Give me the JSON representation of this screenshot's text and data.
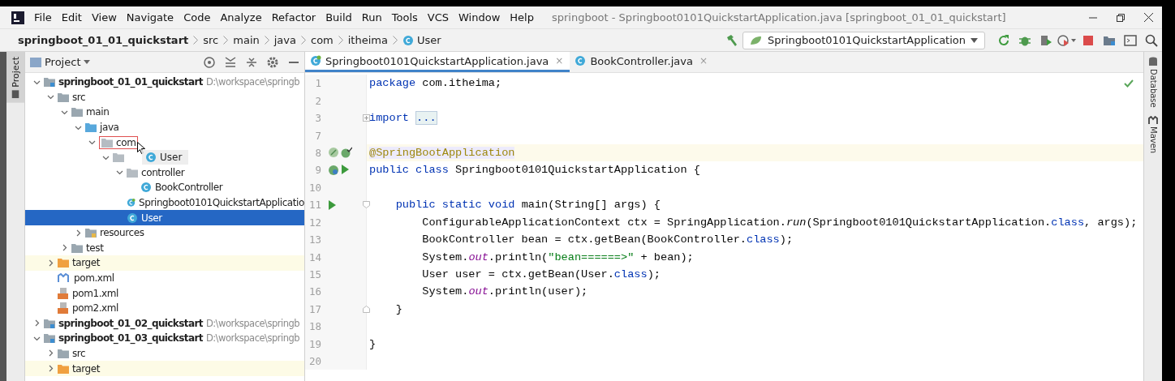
{
  "window": {
    "title": "springboot - Springboot0101QuickstartApplication.java [springboot_01_01_quickstart]"
  },
  "menu": [
    "File",
    "Edit",
    "View",
    "Navigate",
    "Code",
    "Analyze",
    "Refactor",
    "Build",
    "Run",
    "Tools",
    "VCS",
    "Window",
    "Help"
  ],
  "breadcrumbs": [
    {
      "label": "springboot_01_01_quickstart",
      "kind": "module"
    },
    {
      "label": "src",
      "kind": "dir"
    },
    {
      "label": "main",
      "kind": "dir"
    },
    {
      "label": "java",
      "kind": "dir"
    },
    {
      "label": "com",
      "kind": "dir"
    },
    {
      "label": "itheima",
      "kind": "dir"
    },
    {
      "label": "User",
      "kind": "class"
    }
  ],
  "run_config": {
    "label": "Springboot0101QuickstartApplication"
  },
  "side_stripe": {
    "left": "Project",
    "right": [
      "Database",
      "Maven"
    ]
  },
  "project_panel": {
    "title": "Project"
  },
  "tree": [
    {
      "label": "springboot_01_01_quickstart",
      "path": "D:\\workspace\\springb",
      "kind": "module",
      "expanded": true,
      "selected": false,
      "children": [
        {
          "label": "src",
          "kind": "folder",
          "expanded": true,
          "selected": false,
          "children": [
            {
              "label": "main",
              "kind": "folder",
              "expanded": true,
              "selected": false,
              "children": [
                {
                  "label": "java",
                  "kind": "source",
                  "expanded": true,
                  "selected": false,
                  "children": [
                    {
                      "label": "com",
                      "kind": "package",
                      "expanded": true,
                      "selected": false,
                      "drop_target": true,
                      "children": [
                        {
                          "kind": "package",
                          "expanded": true,
                          "selected": false,
                          "drag_ghost": {
                            "label": "User"
                          },
                          "children": [
                            {
                              "label": "controller",
                              "kind": "package",
                              "expanded": true,
                              "selected": false,
                              "children": [
                                {
                                  "label": "BookController",
                                  "kind": "class",
                                  "selected": false
                                }
                              ]
                            },
                            {
                              "label": "Springboot0101QuickstartApplicatio",
                              "kind": "spring",
                              "selected": false
                            },
                            {
                              "label": "User",
                              "kind": "class",
                              "selected": true
                            }
                          ]
                        }
                      ]
                    }
                  ]
                },
                {
                  "label": "resources",
                  "kind": "resources",
                  "expanded": false,
                  "selected": false
                }
              ]
            },
            {
              "label": "test",
              "kind": "folder",
              "expanded": false,
              "selected": false
            }
          ]
        },
        {
          "label": "target",
          "kind": "excluded",
          "expanded": false,
          "selected": false
        },
        {
          "label": "pom.xml",
          "kind": "maven",
          "selected": false
        },
        {
          "label": "pom1.xml",
          "kind": "xml",
          "selected": false
        },
        {
          "label": "pom2.xml",
          "kind": "xml",
          "selected": false
        }
      ]
    },
    {
      "label": "springboot_01_02_quickstart",
      "path": "D:\\workspace\\springb",
      "kind": "module",
      "expanded": false,
      "selected": false
    },
    {
      "label": "springboot_01_03_quickstart",
      "path": "D:\\workspace\\springb",
      "kind": "module",
      "expanded": true,
      "selected": false,
      "children": [
        {
          "label": "src",
          "kind": "folder",
          "expanded": false,
          "selected": false
        },
        {
          "label": "target",
          "kind": "excluded",
          "expanded": false,
          "selected": false
        }
      ]
    }
  ],
  "editor_tabs": [
    {
      "label": "Springboot0101QuickstartApplication.java",
      "kind": "spring",
      "selected": true,
      "close": "×"
    },
    {
      "label": "BookController.java",
      "kind": "class",
      "selected": false,
      "close": "×"
    }
  ],
  "code": [
    {
      "number": "1",
      "current": false,
      "tokens": [
        {
          "kind": "kw",
          "text": "package"
        },
        {
          "kind": "plain",
          "text": " com.itheima;"
        }
      ]
    },
    {
      "number": "2",
      "current": false
    },
    {
      "number": "3",
      "current": false,
      "fold": {
        "kind": "plus"
      },
      "tokens": [
        {
          "kind": "kw",
          "text": "import "
        },
        {
          "kind": "folded",
          "text": "..."
        }
      ]
    },
    {
      "number": "7",
      "current": false
    },
    {
      "number": "8",
      "current": true,
      "gutter": [
        {
          "kind": "bean"
        },
        {
          "kind": "bean-check"
        }
      ],
      "tokens": [
        {
          "kind": "ann",
          "text": "@SpringBootApplication"
        }
      ]
    },
    {
      "number": "9",
      "current": false,
      "gutter": [
        {
          "kind": "spring"
        },
        {
          "kind": "run"
        }
      ],
      "tokens": [
        {
          "kind": "kw",
          "text": "public class"
        },
        {
          "kind": "plain",
          "text": " Springboot0101QuickstartApplication {"
        }
      ]
    },
    {
      "number": "10",
      "current": false
    },
    {
      "number": "11",
      "current": false,
      "gutter": [
        {
          "kind": "run"
        }
      ],
      "fold": {
        "kind": "open"
      },
      "tokens": [
        {
          "kind": "kw",
          "text": "    public static void"
        },
        {
          "kind": "plain",
          "text": " main(String[] args) {"
        }
      ]
    },
    {
      "number": "12",
      "current": false,
      "tokens": [
        {
          "kind": "plain",
          "text": "        ConfigurableApplicationContext ctx = SpringApplication."
        },
        {
          "kind": "method",
          "text": "run"
        },
        {
          "kind": "plain",
          "text": "(Springboot0101QuickstartApplication."
        },
        {
          "kind": "kw",
          "text": "class"
        },
        {
          "kind": "plain",
          "text": ", args);"
        }
      ]
    },
    {
      "number": "13",
      "current": false,
      "tokens": [
        {
          "kind": "plain",
          "text": "        BookController bean = ctx.getBean(BookController."
        },
        {
          "kind": "kw",
          "text": "class"
        },
        {
          "kind": "plain",
          "text": ");"
        }
      ]
    },
    {
      "number": "14",
      "current": false,
      "tokens": [
        {
          "kind": "plain",
          "text": "        System."
        },
        {
          "kind": "field",
          "text": "out"
        },
        {
          "kind": "plain",
          "text": ".println("
        },
        {
          "kind": "str",
          "text": "\"bean======>\""
        },
        {
          "kind": "plain",
          "text": " + bean);"
        }
      ]
    },
    {
      "number": "15",
      "current": false,
      "tokens": [
        {
          "kind": "plain",
          "text": "        User user = ctx.getBean(User."
        },
        {
          "kind": "kw",
          "text": "class"
        },
        {
          "kind": "plain",
          "text": ");"
        }
      ]
    },
    {
      "number": "16",
      "current": false,
      "tokens": [
        {
          "kind": "plain",
          "text": "        System."
        },
        {
          "kind": "field",
          "text": "out"
        },
        {
          "kind": "plain",
          "text": ".println(user);"
        }
      ]
    },
    {
      "number": "17",
      "current": false,
      "fold": {
        "kind": "close"
      },
      "tokens": [
        {
          "kind": "plain",
          "text": "    }"
        }
      ]
    },
    {
      "number": "18",
      "current": false
    },
    {
      "number": "19",
      "current": false,
      "tokens": [
        {
          "kind": "plain",
          "text": "}"
        }
      ]
    },
    {
      "number": "20",
      "current": false
    }
  ]
}
